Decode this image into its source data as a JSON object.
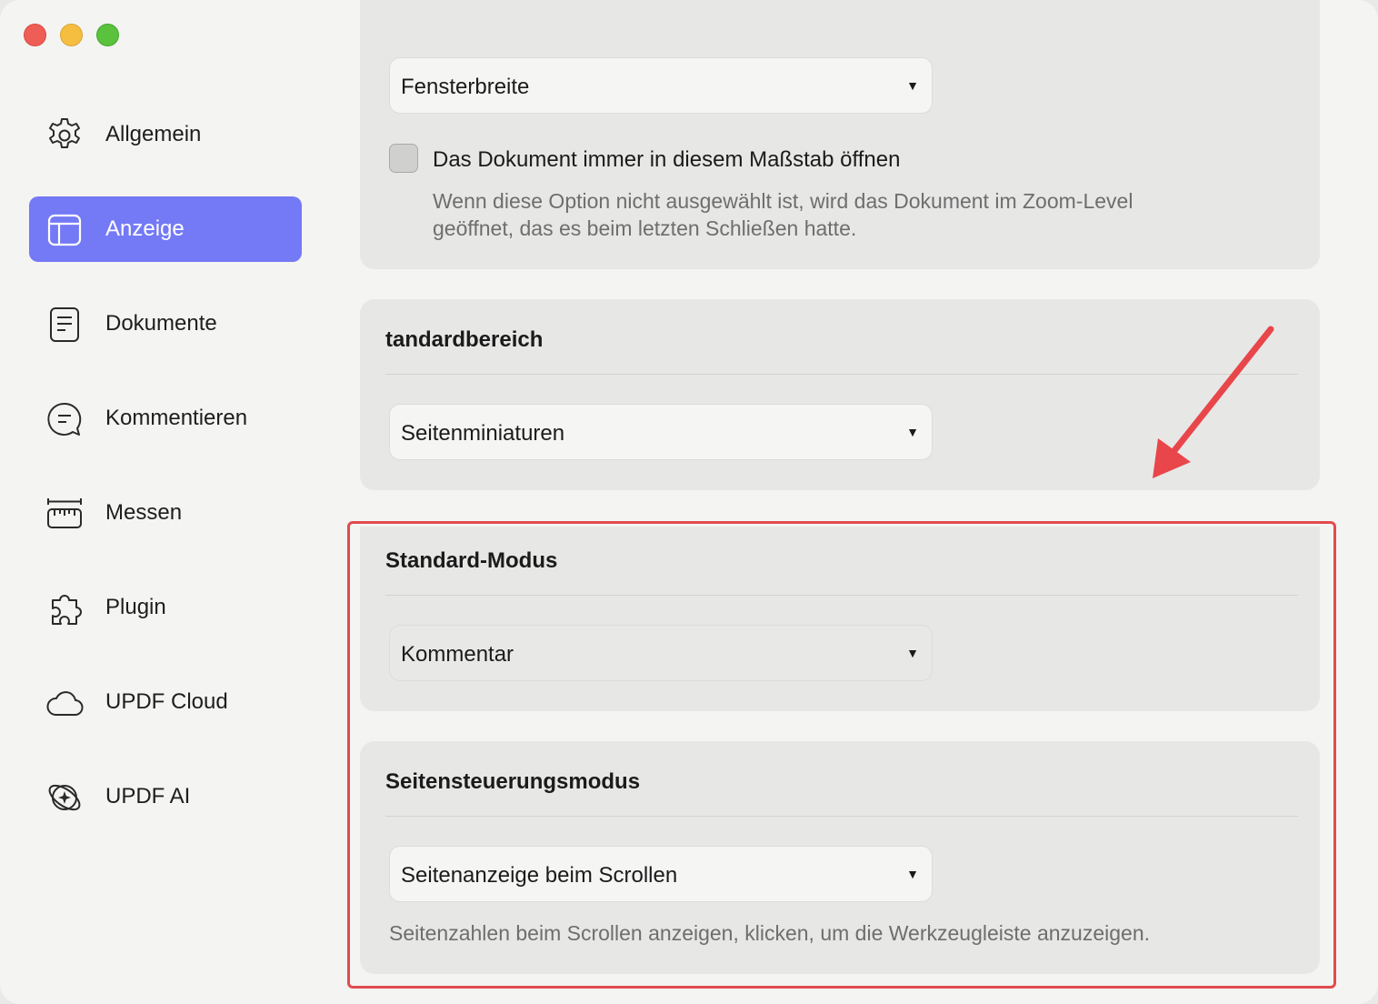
{
  "window": {
    "controls": [
      "close",
      "minimize",
      "maximize"
    ],
    "colors": {
      "close": "#ee5e57",
      "minimize": "#f5be41",
      "maximize": "#5ac23c"
    }
  },
  "sidebar": {
    "accent_color": "#7479f5",
    "items": [
      {
        "label": "Allgemein",
        "icon": "gear-icon",
        "active": false
      },
      {
        "label": "Anzeige",
        "icon": "layout-icon",
        "active": true
      },
      {
        "label": "Dokumente",
        "icon": "document-icon",
        "active": false
      },
      {
        "label": "Kommentieren",
        "icon": "comment-icon",
        "active": false
      },
      {
        "label": "Messen",
        "icon": "ruler-icon",
        "active": false
      },
      {
        "label": "Plugin",
        "icon": "puzzle-icon",
        "active": false
      },
      {
        "label": "UPDF Cloud",
        "icon": "cloud-icon",
        "active": false
      },
      {
        "label": "UPDF AI",
        "icon": "ai-icon",
        "active": false
      }
    ]
  },
  "zoom_section": {
    "select_value": "Fensterbreite",
    "checkbox_label": "Das Dokument immer in diesem Maßstab öffnen",
    "checkbox_checked": false,
    "hint_line1": "Wenn diese Option nicht ausgewählt ist, wird das Dokument im Zoom-Level",
    "hint_line2": "geöffnet, das es beim letzten Schließen hatte."
  },
  "standard_area": {
    "title": "tandardbereich",
    "select_value": "Seitenminiaturen"
  },
  "standard_mode": {
    "title": "Standard-Modus",
    "select_value": "Kommentar"
  },
  "page_control": {
    "title": "Seitensteuerungsmodus",
    "select_value": "Seitenanzeige beim Scrollen",
    "hint": "Seitenzahlen beim Scrollen anzeigen, klicken, um die Werkzeugleiste anzuzeigen."
  },
  "annotation": {
    "highlight_color": "#e24b4f",
    "arrow_color": "#e8464a"
  }
}
